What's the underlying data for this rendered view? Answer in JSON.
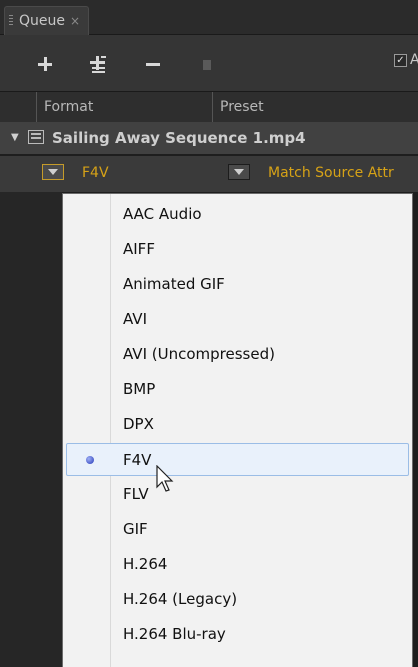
{
  "tab": {
    "title": "Queue",
    "close_glyph": "×"
  },
  "toolbar": {
    "icons": [
      "plus-icon",
      "add-output-icon",
      "minus-icon",
      "duplicate-icon"
    ],
    "auto_label": "Aut",
    "auto_checked": true
  },
  "columns": {
    "format": "Format",
    "preset": "Preset"
  },
  "queue_item": {
    "name": "Sailing Away Sequence 1.mp4",
    "format": "F4V",
    "preset": "Match Source Attr"
  },
  "menu": {
    "items": [
      {
        "label": "AAC Audio"
      },
      {
        "label": "AIFF"
      },
      {
        "label": "Animated GIF"
      },
      {
        "label": "AVI"
      },
      {
        "label": "AVI (Uncompressed)"
      },
      {
        "label": "BMP"
      },
      {
        "label": "DPX"
      },
      {
        "label": "F4V",
        "selected": true
      },
      {
        "label": "FLV"
      },
      {
        "label": "GIF"
      },
      {
        "label": "H.264"
      },
      {
        "label": "H.264 (Legacy)"
      },
      {
        "label": "H.264 Blu-ray"
      }
    ],
    "selected_index": 7
  },
  "colors": {
    "accent": "#d6a217",
    "selection_bg": "#e9f1fb",
    "selection_border": "#9bbde6"
  }
}
